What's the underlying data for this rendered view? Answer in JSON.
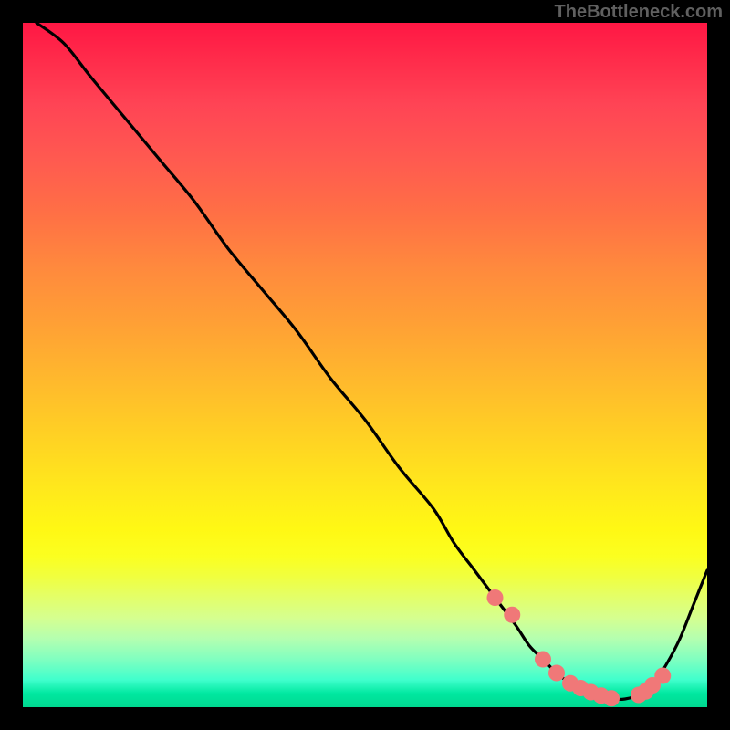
{
  "watermark": "TheBottleneck.com",
  "chart_data": {
    "type": "line",
    "title": "",
    "xlabel": "",
    "ylabel": "",
    "xlim": [
      0,
      100
    ],
    "ylim": [
      0,
      100
    ],
    "grid": false,
    "series": [
      {
        "name": "curve",
        "color": "#000000",
        "x": [
          2,
          6,
          10,
          15,
          20,
          25,
          30,
          35,
          40,
          45,
          50,
          55,
          60,
          63,
          66,
          69,
          72,
          74,
          76,
          78,
          80,
          82,
          84,
          86,
          88,
          90,
          92,
          94,
          96,
          98,
          100
        ],
        "values": [
          100,
          97,
          92,
          86,
          80,
          74,
          67,
          61,
          55,
          48,
          42,
          35,
          29,
          24,
          20,
          16,
          12,
          9,
          7,
          5,
          3.5,
          2.4,
          1.6,
          1.2,
          1.2,
          1.8,
          3.2,
          6.2,
          10,
          15,
          20
        ]
      }
    ],
    "markers": {
      "name": "highlight-dots",
      "color": "#f07878",
      "radius": 9,
      "x": [
        69,
        71.5,
        76,
        78,
        80,
        81.5,
        83,
        84.5,
        86,
        90,
        91,
        92,
        93.5
      ],
      "values": [
        16,
        13.5,
        7,
        5,
        3.5,
        2.8,
        2.2,
        1.7,
        1.3,
        1.8,
        2.3,
        3.2,
        4.6
      ]
    },
    "background_gradient": {
      "top": "#ff1744",
      "mid": "#ffe81c",
      "bottom": "#00d890"
    }
  }
}
